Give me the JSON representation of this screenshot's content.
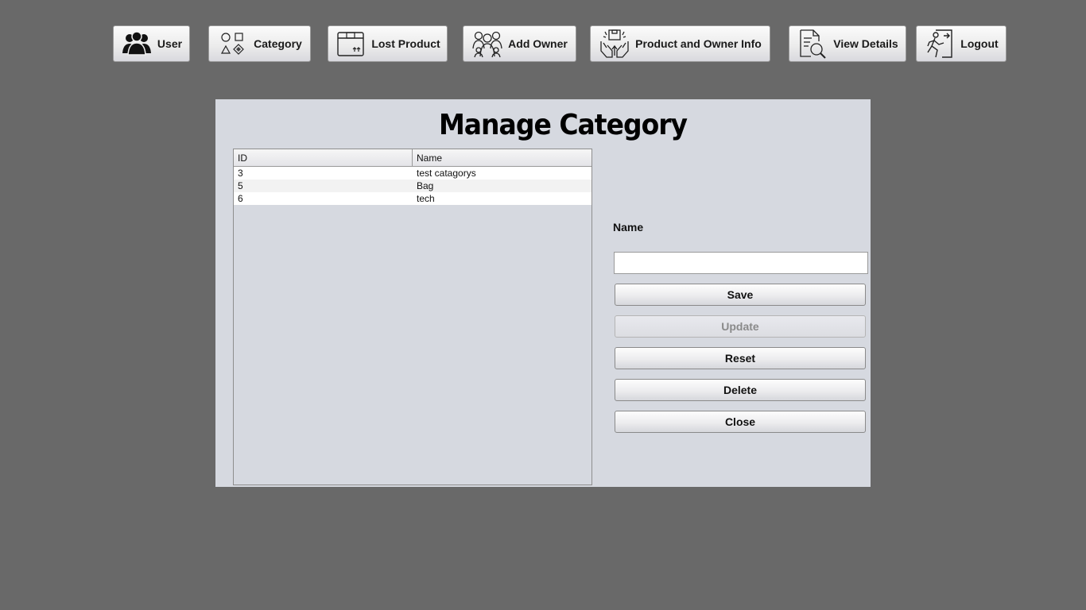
{
  "nav": {
    "user": "User",
    "category": "Category",
    "lost_product": "Lost Product",
    "add_owner": "Add Owner",
    "product_owner_info": "Product and Owner Info",
    "view_details": "View Details",
    "logout": "Logout"
  },
  "page": {
    "title": "Manage Category"
  },
  "table": {
    "headers": {
      "id": "ID",
      "name": "Name"
    },
    "rows": [
      {
        "id": "3",
        "name": "test catagorys"
      },
      {
        "id": "5",
        "name": "Bag"
      },
      {
        "id": "6",
        "name": "tech"
      }
    ]
  },
  "form": {
    "name_label": "Name",
    "name_value": "",
    "save": "Save",
    "update": "Update",
    "reset": "Reset",
    "delete": "Delete",
    "close": "Close"
  }
}
